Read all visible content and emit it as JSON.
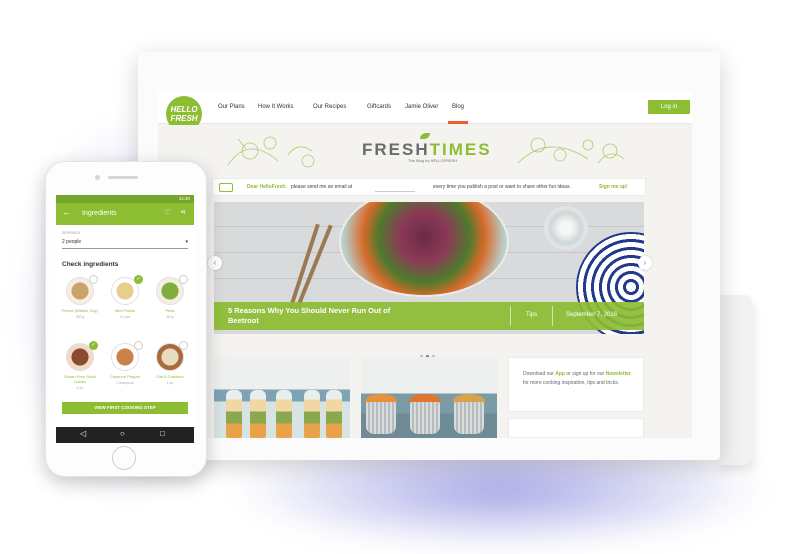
{
  "site": {
    "logo_text": "HELLO FRESH",
    "nav": [
      "Our Plans",
      "How It Works",
      "Our Recipes",
      "Giftcards",
      "Jamie Oliver",
      "Blog"
    ],
    "login_label": "Log in",
    "masthead_title_a": "FRESH",
    "masthead_title_b": "TIMES",
    "masthead_subtitle": "The Blog by HELLOFRESH"
  },
  "email_bar": {
    "prefix": "Dear HelloFresh,",
    "message": "please send me an email at",
    "suffix": "every time you publish a post or want to share other fun ideas.",
    "cta": "Sign me up!"
  },
  "hero": {
    "title": "5 Reasons Why You Should Never Run Out of Beetroot",
    "tag": "Tips",
    "date": "September 7, 2016",
    "prev_icon": "‹",
    "next_icon": "›"
  },
  "promo": {
    "text_a": "Download our",
    "app": "App",
    "text_b": "or sign up for our",
    "newsletter": "Newsletter",
    "text_c": "for more cooking inspiration, tips and tricks."
  },
  "phone": {
    "time": "12:30",
    "title": "Ingredients",
    "back_icon": "←",
    "heart_icon": "♡",
    "share_icon": "⋖",
    "serving_label": "SERVINGS",
    "serving_value": "2 people",
    "check_title": "Check ingredients",
    "ingredients": [
      {
        "name": "Penne (Wheat, Soy)",
        "qty": "250 g",
        "checked": false,
        "color": "#c9a36b"
      },
      {
        "name": "Mini Potato",
        "qty": "12 pcs",
        "checked": true,
        "color": "#e6cf8d"
      },
      {
        "name": "Peas",
        "qty": "80 g",
        "checked": false,
        "color": "#7fae3c"
      },
      {
        "name": "Gluten Free Stock Cubes",
        "qty": "1 pc",
        "checked": true,
        "color": "#8a4a2e"
      },
      {
        "name": "Cayenne Pepper",
        "qty": "1 teaspoon",
        "checked": false,
        "color": "#c9824a"
      },
      {
        "name": "Oat & Crackers",
        "qty": "1 pc",
        "checked": false,
        "color": "#e8dcc0"
      }
    ],
    "cta": "VIEW FIRST COOKING STEP",
    "nav_back": "◁",
    "nav_home": "○",
    "nav_recent": "□"
  },
  "colors": {
    "brand_green": "#8cbd32",
    "accent_orange": "#e85e2e"
  }
}
